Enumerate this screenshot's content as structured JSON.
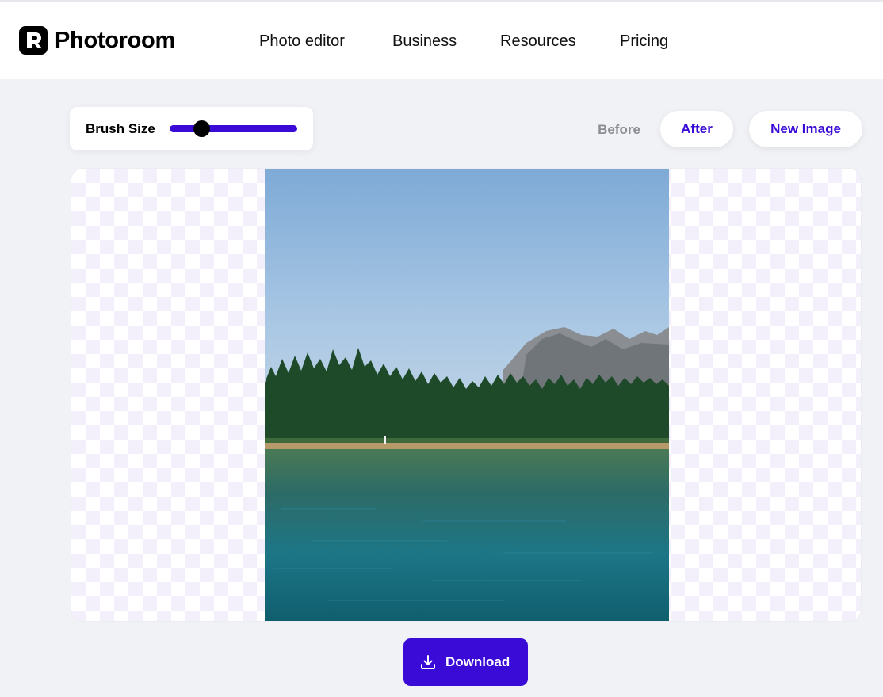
{
  "brand": {
    "name": "Photoroom"
  },
  "nav": [
    {
      "label": "Photo editor"
    },
    {
      "label": "Business"
    },
    {
      "label": "Resources"
    },
    {
      "label": "Pricing"
    }
  ],
  "toolbar": {
    "brush_label": "Brush Size",
    "brush_value": 0.25,
    "before_label": "Before",
    "after_label": "After",
    "new_image_label": "New Image"
  },
  "actions": {
    "download_label": "Download"
  },
  "colors": {
    "accent": "#3a0bd6",
    "page_bg": "#f1f2f6",
    "muted_text": "#8d8d94"
  },
  "icons": [
    "photoroom-logo-icon",
    "download-icon"
  ]
}
